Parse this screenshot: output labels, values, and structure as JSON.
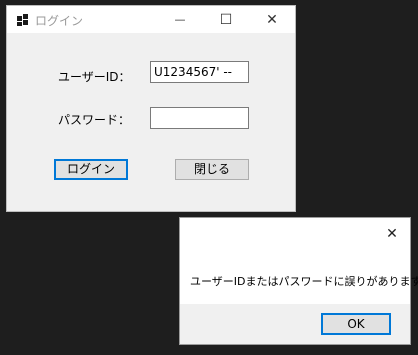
{
  "login_window": {
    "title": "ログイン",
    "minimize_glyph": "—",
    "maximize_glyph": "☐",
    "close_glyph": "✕",
    "user_id_label": "ユーザーID：",
    "user_id_value": "U1234567' --",
    "password_label": "パスワード：",
    "password_value": "",
    "login_button": "ログイン",
    "close_button": "閉じる"
  },
  "error_dialog": {
    "close_glyph": "✕",
    "message": "ユーザーIDまたはパスワードに誤りがあります。",
    "ok_button": "OK"
  },
  "colors": {
    "desktop": "#1e1e1e",
    "window_body": "#f0f0f0",
    "accent": "#0078d7"
  }
}
